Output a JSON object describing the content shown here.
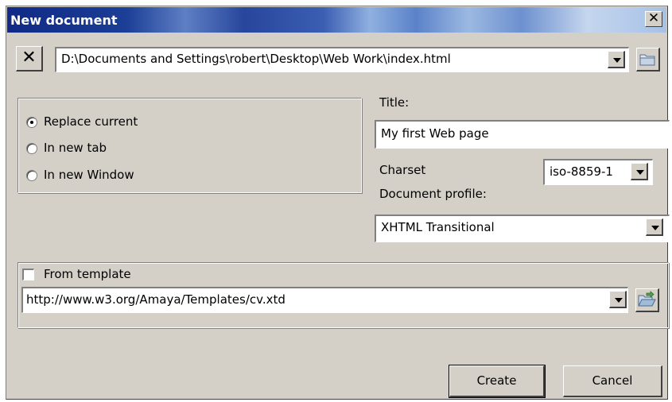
{
  "window": {
    "title": "New document"
  },
  "location": {
    "value": "D:\\Documents and Settings\\robert\\Desktop\\Web Work\\index.html"
  },
  "open_in": {
    "options": [
      {
        "label": "Replace current",
        "selected": true
      },
      {
        "label": "In new tab",
        "selected": false
      },
      {
        "label": "In new Window",
        "selected": false
      }
    ]
  },
  "title_field": {
    "label": "Title:",
    "value": "My first Web page"
  },
  "charset": {
    "label": "Charset",
    "value": "iso-8859-1"
  },
  "profile": {
    "label": "Document profile:",
    "value": "XHTML Transitional"
  },
  "template": {
    "checkbox_label": "From template",
    "checked": false,
    "url": "http://www.w3.org/Amaya/Templates/cv.xtd"
  },
  "buttons": {
    "create": "Create",
    "cancel": "Cancel"
  },
  "icons": {
    "clear": "close-icon",
    "browse_folder": "folder-icon",
    "browse_template": "folder-open-icon",
    "dropdown": "chevron-down-icon"
  }
}
